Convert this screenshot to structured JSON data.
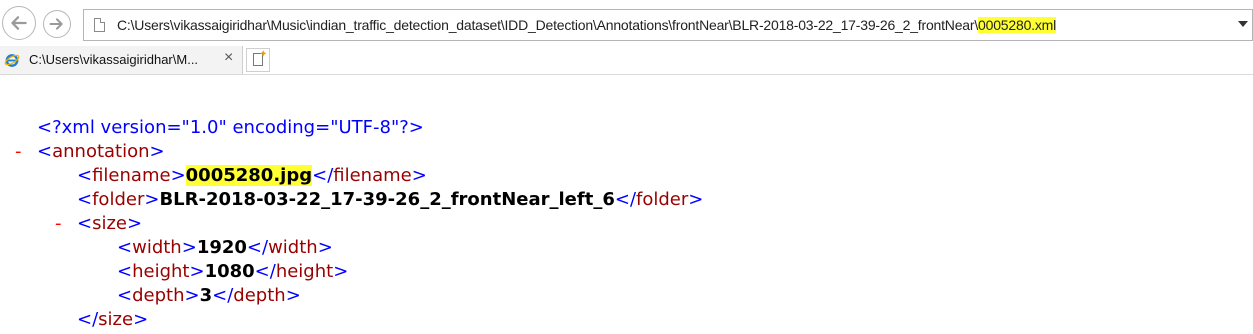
{
  "address_bar": {
    "url_prefix": "C:\\Users\\vikassaigiridhar\\Music\\indian_traffic_detection_dataset\\IDD_Detection\\Annotations\\frontNear\\BLR-2018-03-22_17-39-26_2_frontNear\\",
    "url_highlight": "0005280.xml"
  },
  "tab": {
    "title": "C:\\Users\\vikassaigiridhar\\M...",
    "close_glyph": "×"
  },
  "xml": {
    "declaration": "<?xml version=\"1.0\" encoding=\"UTF-8\"?>",
    "collapse_glyph": "-",
    "root_tag": "annotation",
    "filename_tag": "filename",
    "filename_value": "0005280.jpg",
    "folder_tag": "folder",
    "folder_value": "BLR-2018-03-22_17-39-26_2_frontNear_left_6",
    "size_tag": "size",
    "width_tag": "width",
    "width_value": "1920",
    "height_tag": "height",
    "height_value": "1080",
    "depth_tag": "depth",
    "depth_value": "3"
  },
  "colors": {
    "tag": "#990000",
    "bracket": "#0000ff",
    "highlight": "#ffff33",
    "collapse": "#ff0000"
  }
}
